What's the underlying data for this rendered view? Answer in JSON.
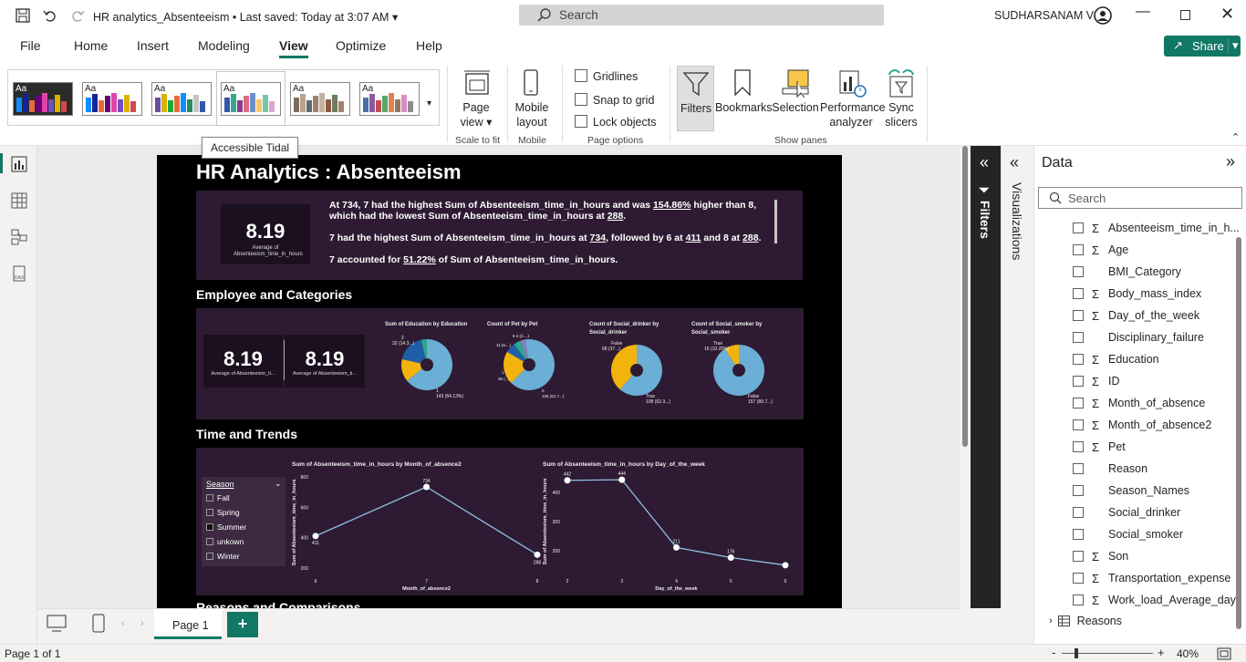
{
  "titlebar": {
    "title": "HR analytics_Absenteeism",
    "saved": " • Last saved: Today at 3:07 AM",
    "search_label": "Search",
    "user": "SUDHARSANAM V"
  },
  "menu": {
    "file": "File",
    "home": "Home",
    "insert": "Insert",
    "modeling": "Modeling",
    "view": "View",
    "optimize": "Optimize",
    "help": "Help",
    "share": "Share"
  },
  "ribbon": {
    "themes": [
      {
        "label": "Aa",
        "colors": [
          "#118dff",
          "#12239e",
          "#e66c37",
          "#6b007b",
          "#e044a7",
          "#744ec2",
          "#d9b300",
          "#d64550"
        ]
      },
      {
        "label": "Aa",
        "colors": [
          "#118dff",
          "#12239e",
          "#e66c37",
          "#6b007b",
          "#e044a7",
          "#744ec2",
          "#d9b300",
          "#d64550"
        ]
      },
      {
        "label": "Aa",
        "colors": [
          "#6b4e9b",
          "#d9b300",
          "#1aab40",
          "#e66c37",
          "#118dff",
          "#2a8c5a",
          "#c4c4c4",
          "#3257a8"
        ]
      },
      {
        "label": "Aa",
        "colors": [
          "#3257a8",
          "#37a794",
          "#8b3d88",
          "#dd6b7f",
          "#6b91c9",
          "#f5c869",
          "#77c4a8",
          "#dea6cf"
        ]
      },
      {
        "label": "Aa",
        "colors": [
          "#7c6c5d",
          "#b8a38f",
          "#5f6b73",
          "#9e7f6d",
          "#c2b19f",
          "#8a5a44",
          "#6f7c5e",
          "#a57f6d"
        ]
      },
      {
        "label": "Aa",
        "colors": [
          "#4a6fa5",
          "#8a5a9e",
          "#c44e52",
          "#55a868",
          "#dd8452",
          "#937860",
          "#da8bc3",
          "#8c8c8c"
        ]
      }
    ],
    "tooltip": "Accessible Tidal",
    "page_view": "Page view",
    "mobile_layout": "Mobile layout",
    "gridlines": "Gridlines",
    "snap": "Snap to grid",
    "lock": "Lock objects",
    "filters": "Filters",
    "bookmarks": "Bookmarks",
    "selection": "Selection",
    "performance": "Performance analyzer",
    "sync": "Sync slicers",
    "groups": {
      "scale": "Scale to fit",
      "mobile": "Mobile",
      "page_options": "Page options",
      "show_panes": "Show panes"
    }
  },
  "report": {
    "title": "HR Analytics : Absenteeism",
    "kpi1": {
      "value": "8.19",
      "label": "Average of Absenteeism_time_in_hours"
    },
    "narrative": {
      "p1a": "At 734, 7 had the highest Sum of Absenteeism_time_in_hours and was ",
      "p1b": "154.86%",
      "p1c": " higher than 8, which had the lowest Sum of Absenteeism_time_in_hours at ",
      "p1d": "288",
      "p2a": "7 had the highest Sum of Absenteeism_time_in_hours at ",
      "p2b": "734",
      "p2c": ", followed by 6 at ",
      "p2d": "411",
      "p2e": " and 8 at ",
      "p2f": "288",
      "p3a": "7 accounted for ",
      "p3b": "51.22%",
      "p3c": " of Sum of Absenteeism_time_in_hours."
    },
    "sec2": "Employee and Categories",
    "kpi2": {
      "value": "8.19",
      "label": "Average of Absenteeism_ti..."
    },
    "kpi3": {
      "value": "8.19",
      "label": "Average of Absenteeism_ti..."
    },
    "pie_colors": [
      "#6baed6",
      "#f2b40c",
      "#1f5fa8",
      "#2ca58d",
      "#8e7cc3"
    ],
    "pies": [
      {
        "title": "Sum of Education by Education",
        "labels": [
          "2",
          "32 (14.3...)",
          "1",
          "143 (64.13%)"
        ],
        "values": [
          143,
          32,
          40,
          8
        ]
      },
      {
        "title": "Count of Pet by Pet",
        "labels": [
          "8 4 (2....)",
          "11 (6....)",
          "1",
          "36 (...)",
          "0",
          "106 (61.7...)"
        ],
        "values": [
          106,
          36,
          11,
          8,
          5,
          4
        ]
      },
      {
        "title": "Count of Social_drinker by Social_drinker",
        "labels": [
          "False",
          "68 (37...)",
          "True",
          "108 (62.3...)"
        ],
        "values": [
          108,
          68
        ]
      },
      {
        "title": "Count of Social_smoker by Social_smoker",
        "labels": [
          "True",
          "16 (10.25%)",
          "False",
          "157 (89.7...)"
        ],
        "values": [
          157,
          16
        ]
      }
    ],
    "sec3": "Time and Trends",
    "slicer": {
      "title": "Season",
      "items": [
        "Fall",
        "Spring",
        "Summer",
        "unkown",
        "Winter"
      ]
    },
    "sec4": "Reasons and Comparisons"
  },
  "chart_data": [
    {
      "type": "line",
      "title": "Sum of Absenteeism_time_in_hours by Month_of_absence2",
      "xlabel": "Month_of_absence2",
      "ylabel": "Sum of Absenteeism_time_in_hours",
      "x": [
        "6",
        "7",
        "8"
      ],
      "values": [
        411,
        734,
        288
      ],
      "yticks": [
        "800",
        "600",
        "400",
        "200"
      ],
      "ylim": [
        200,
        800
      ]
    },
    {
      "type": "line",
      "title": "Sum of Absenteeism_time_in_hours by Day_of_the_week",
      "xlabel": "Day_of_the_week",
      "ylabel": "Sum of Absenteeism_time_in_hours",
      "x": [
        "2",
        "3",
        "4",
        "5",
        "6"
      ],
      "values": [
        442,
        444,
        211,
        176,
        150
      ],
      "value_labels": [
        "442",
        "444",
        "211",
        "176",
        ""
      ],
      "yticks": [
        "400",
        "300",
        "200"
      ],
      "ylim": [
        140,
        460
      ]
    }
  ],
  "panes": {
    "filters": "Filters",
    "visualizations": "Visualizations",
    "data": "Data",
    "search_placeholder": "Search",
    "fields": [
      {
        "name": "Absenteeism_time_in_h...",
        "sigma": true
      },
      {
        "name": "Age",
        "sigma": true
      },
      {
        "name": "BMI_Category",
        "sigma": false
      },
      {
        "name": "Body_mass_index",
        "sigma": true
      },
      {
        "name": "Day_of_the_week",
        "sigma": true
      },
      {
        "name": "Disciplinary_failure",
        "sigma": false
      },
      {
        "name": "Education",
        "sigma": true
      },
      {
        "name": "ID",
        "sigma": true
      },
      {
        "name": "Month_of_absence",
        "sigma": true
      },
      {
        "name": "Month_of_absence2",
        "sigma": true
      },
      {
        "name": "Pet",
        "sigma": true
      },
      {
        "name": "Reason",
        "sigma": false
      },
      {
        "name": "Season_Names",
        "sigma": false
      },
      {
        "name": "Social_drinker",
        "sigma": false
      },
      {
        "name": "Social_smoker",
        "sigma": false
      },
      {
        "name": "Son",
        "sigma": true
      },
      {
        "name": "Transportation_expense",
        "sigma": true
      },
      {
        "name": "Work_load_Average_day",
        "sigma": true
      }
    ],
    "table": "Reasons"
  },
  "tabs": {
    "page1": "Page 1",
    "add": "+"
  },
  "status": {
    "page": "Page 1 of 1",
    "zoom": "40%",
    "minus": "-",
    "plus": "+"
  }
}
